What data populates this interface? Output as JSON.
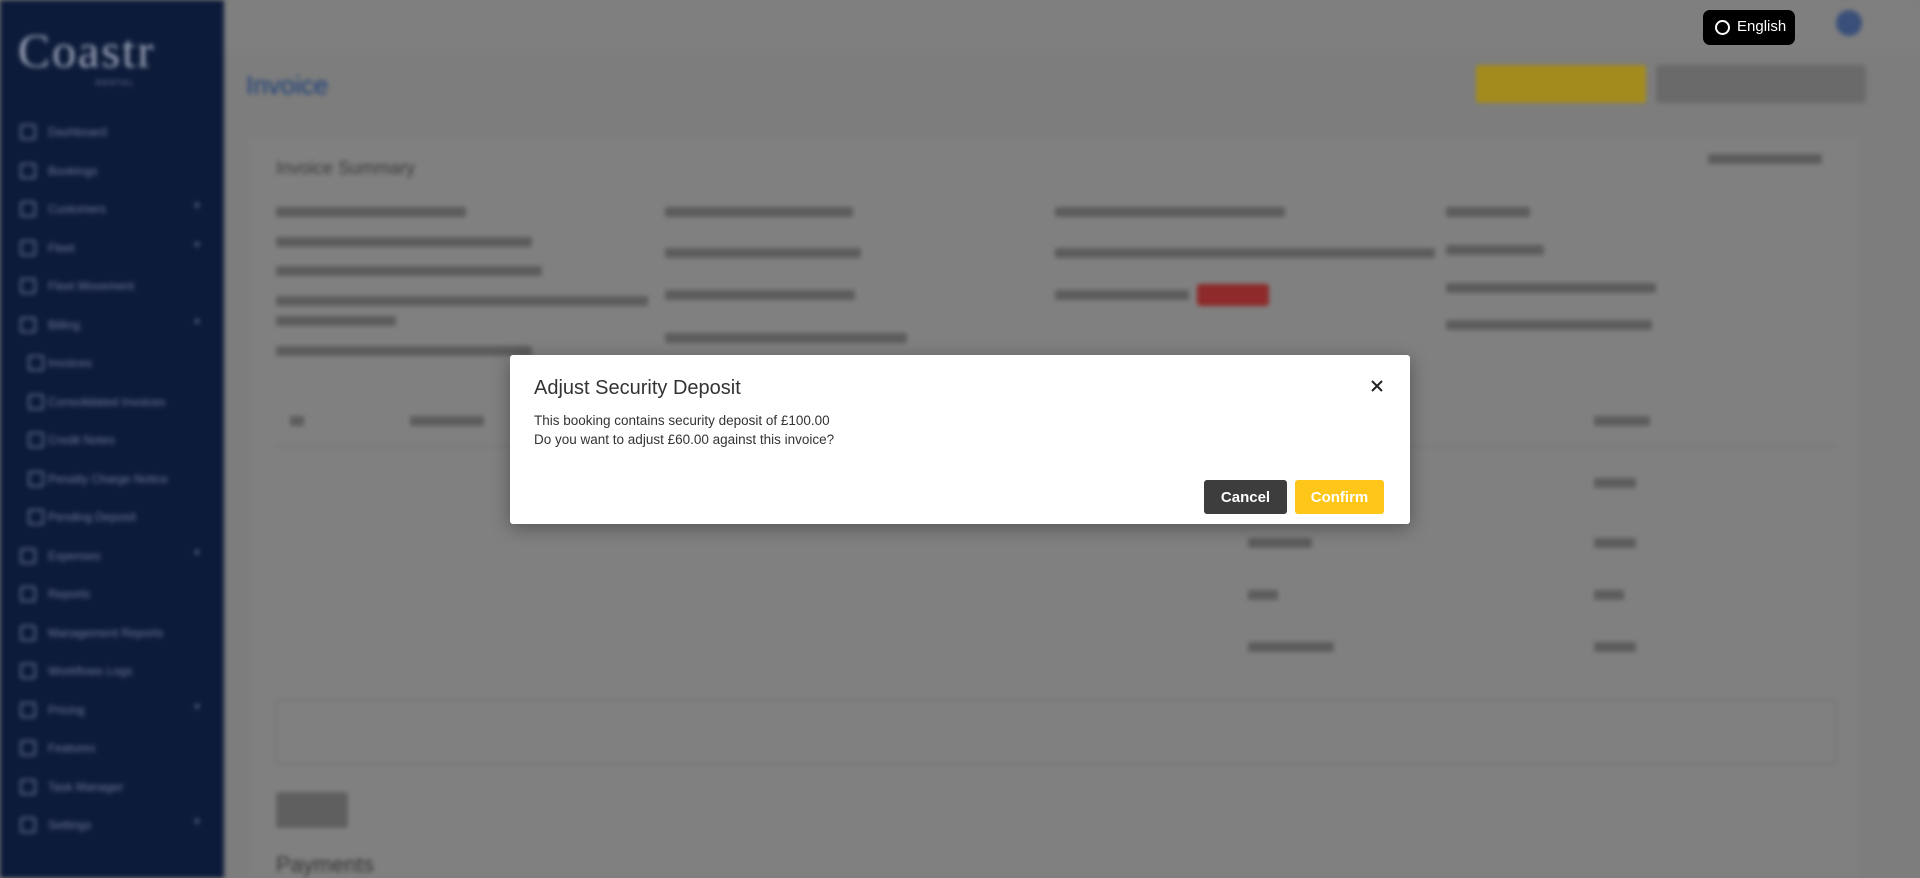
{
  "language": {
    "label": "English",
    "icon": "globe-icon"
  },
  "modal": {
    "title": "Adjust Security Deposit",
    "line1": "This booking contains security deposit of £100.00",
    "line2": "Do you want to adjust £60.00 against this invoice?",
    "cancel_label": "Cancel",
    "confirm_label": "Confirm",
    "close_icon": "close-icon"
  },
  "colors": {
    "accent": "#ffc61a",
    "cancel": "#3d3d3d",
    "sidebar": "#0d1b3a",
    "overlay": "#7d7d7d"
  }
}
